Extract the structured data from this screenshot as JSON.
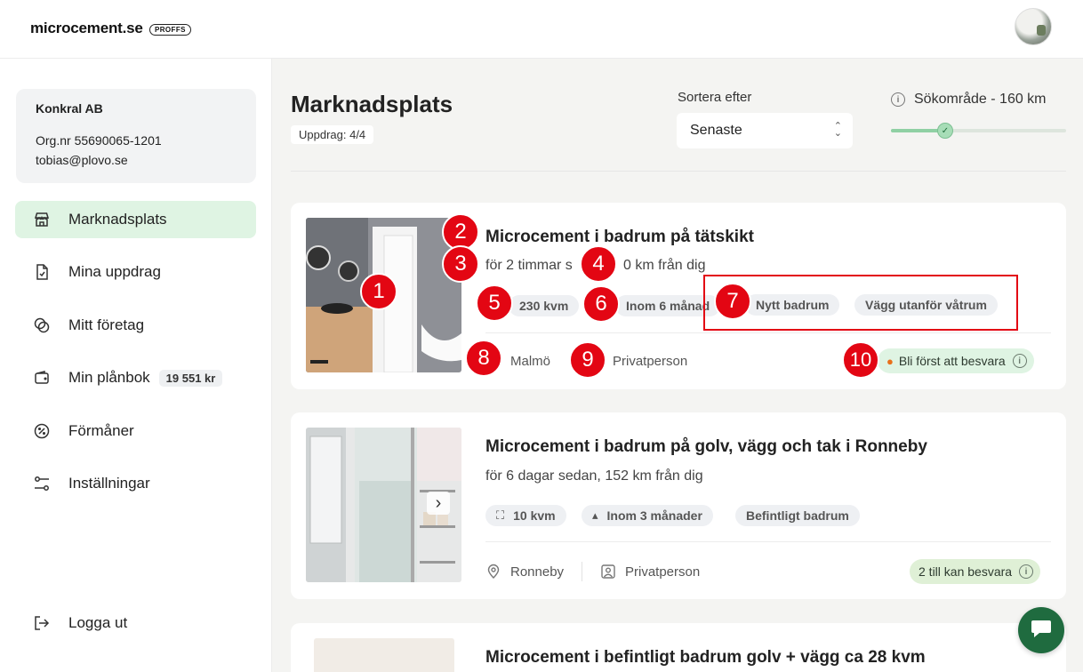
{
  "brand": {
    "name": "microcement.se",
    "badge": "PROFFS"
  },
  "company": {
    "name": "Konkral AB",
    "org": "Org.nr 55690065-1201",
    "email": "tobias@plovo.se"
  },
  "nav": {
    "items": [
      {
        "label": "Marknadsplats",
        "icon": "store-icon"
      },
      {
        "label": "Mina uppdrag",
        "icon": "document-icon"
      },
      {
        "label": "Mitt företag",
        "icon": "overlap-circles-icon"
      },
      {
        "label": "Min plånbok",
        "icon": "wallet-icon",
        "badge": "19 551 kr"
      },
      {
        "label": "Förmåner",
        "icon": "percent-icon"
      },
      {
        "label": "Inställningar",
        "icon": "sliders-icon"
      }
    ],
    "logout": "Logga ut"
  },
  "page": {
    "title": "Marknadsplats",
    "count": "Uppdrag: 4/4"
  },
  "sort": {
    "label": "Sortera efter",
    "value": "Senaste"
  },
  "search_area": {
    "label": "Sökområde - 160 km",
    "slider_fraction": 0.31
  },
  "listings": [
    {
      "title": "Microcement i badrum på tätskikt",
      "time": "för 2 timmar s",
      "distance": "0 km från dig",
      "chips": [
        "230 kvm",
        "Inom 6 månad",
        "Nytt badrum",
        "Vägg utanför våtrum"
      ],
      "city": "Malmö",
      "customer": "Privatperson",
      "status": "Bli först att besvara"
    },
    {
      "title": "Microcement i badrum på golv, vägg och tak i Ronneby",
      "subtitle": "för 6 dagar sedan, 152 km från dig",
      "chips": [
        "10 kvm",
        "Inom 3 månader",
        "Befintligt badrum"
      ],
      "city": "Ronneby",
      "customer": "Privatperson",
      "status": "2 till kan besvara"
    },
    {
      "title": "Microcement i befintligt badrum golv + vägg ca 28 kvm"
    }
  ],
  "markers": [
    "1",
    "2",
    "3",
    "4",
    "5",
    "6",
    "7",
    "8",
    "9",
    "10"
  ],
  "colors": {
    "accent": "#dff4e3",
    "annotation": "#e30613",
    "chat": "#1f6b3f"
  }
}
